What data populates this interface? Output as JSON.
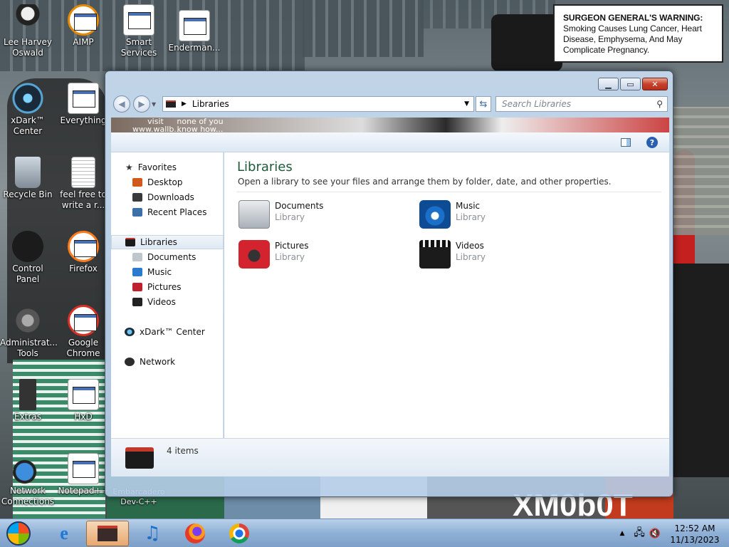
{
  "warning": {
    "heading": "SURGEON GENERAL'S WARNING:",
    "text": "Smoking Causes Lung Cancer, Heart Disease, Emphysema, And May Complicate Pregnancy."
  },
  "desktop_icons": [
    {
      "label": "Lee Harvey Oswald",
      "icon": "person-icon"
    },
    {
      "label": "AIMP",
      "icon": "app-icon"
    },
    {
      "label": "Smart Services",
      "icon": "gear-icon"
    },
    {
      "label": "Enderman...",
      "icon": "app-icon"
    },
    {
      "label": "xDark™ Center",
      "icon": "xdark-icon"
    },
    {
      "label": "Everything",
      "icon": "app-icon"
    },
    {
      "label": "Recycle Bin",
      "icon": "recycle-bin-icon"
    },
    {
      "label": "feel free to write a r...",
      "icon": "document-icon"
    },
    {
      "label": "Control Panel",
      "icon": "control-panel-icon"
    },
    {
      "label": "Firefox",
      "icon": "app-icon"
    },
    {
      "label": "Administrat... Tools",
      "icon": "tools-icon"
    },
    {
      "label": "Google Chrome",
      "icon": "app-icon"
    },
    {
      "label": "Extras",
      "icon": "folder-icon"
    },
    {
      "label": "HxD",
      "icon": "app-icon"
    },
    {
      "label": "Network Connections",
      "icon": "network-icon"
    },
    {
      "label": "Notepad++",
      "icon": "app-icon"
    },
    {
      "label": "Embarcadero Dev-C++",
      "icon": "app-icon"
    }
  ],
  "behind_window_text": {
    "left": "visit www.wallb...",
    "right": "none of you know how..."
  },
  "wallpaper_text": "XM0b0T",
  "explorer": {
    "address": "Libraries",
    "search_placeholder": "Search Libraries",
    "nav": {
      "favorites": "Favorites",
      "desktop": "Desktop",
      "downloads": "Downloads",
      "recent": "Recent Places",
      "libraries": "Libraries",
      "documents": "Documents",
      "music": "Music",
      "pictures": "Pictures",
      "videos": "Videos",
      "xdark": "xDark™ Center",
      "network": "Network"
    },
    "title": "Libraries",
    "subtitle": "Open a library to see your files and arrange them by folder, date, and other properties.",
    "libraries": [
      {
        "name": "Documents",
        "type": "Library"
      },
      {
        "name": "Music",
        "type": "Library"
      },
      {
        "name": "Pictures",
        "type": "Library"
      },
      {
        "name": "Videos",
        "type": "Library"
      }
    ],
    "item_count": "4 items"
  },
  "taskbar": {
    "time": "12:52 AM",
    "date": "11/13/2023"
  }
}
